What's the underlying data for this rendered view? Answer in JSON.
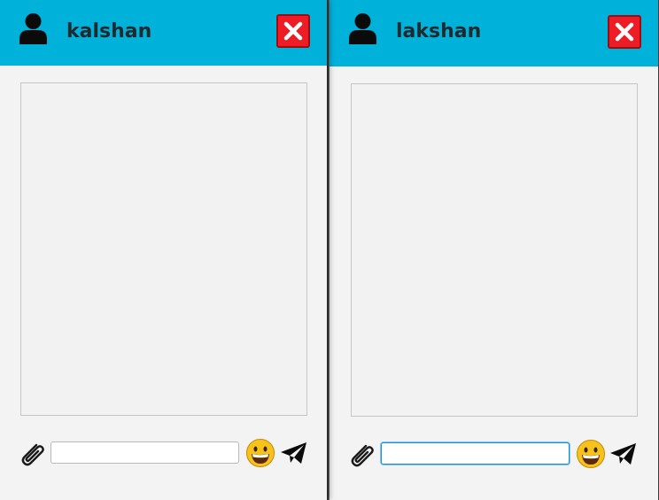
{
  "chats": [
    {
      "username": "kalshan",
      "input_value": "",
      "icons": {
        "user": "user-icon",
        "close": "close-icon",
        "attach": "paperclip-icon",
        "emoji": "smiley-emoji-icon",
        "send": "paper-plane-icon"
      }
    },
    {
      "username": "lakshan",
      "input_value": "",
      "focused": true,
      "icons": {
        "user": "user-icon",
        "close": "close-icon",
        "attach": "paperclip-icon",
        "emoji": "smiley-emoji-icon",
        "send": "paper-plane-icon"
      }
    }
  ],
  "colors": {
    "header": "#00b1da",
    "close_button": "#ee1c24",
    "panel_background": "#f3f3f3",
    "focus_border": "#1f8ed6"
  }
}
